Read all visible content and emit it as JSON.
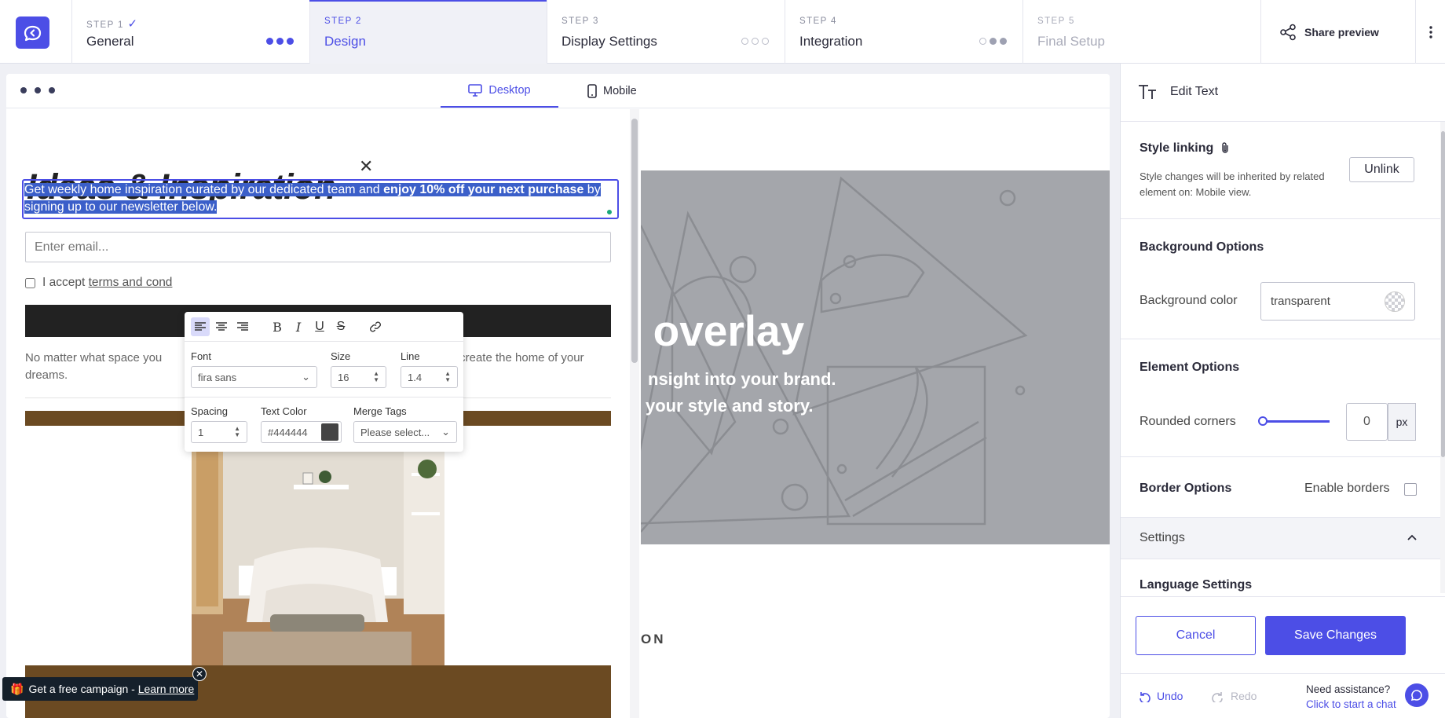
{
  "steps": [
    {
      "label": "STEP 1",
      "check": "✓",
      "name": "General"
    },
    {
      "label": "STEP 2",
      "name": "Design"
    },
    {
      "label": "STEP 3",
      "name": "Display Settings"
    },
    {
      "label": "STEP 4",
      "name": "Integration"
    },
    {
      "label": "STEP 5",
      "name": "Final Setup"
    }
  ],
  "header": {
    "share": "Share preview"
  },
  "canvas": {
    "desktop": "Desktop",
    "mobile": "Mobile"
  },
  "popup": {
    "headline": "Ideas & Inspiration",
    "text_pre": "Get weekly home inspiration curated by our dedicated team and ",
    "text_bold": "enjoy 10% off your next purchase",
    "text_post": " by signing up to our newsletter below.",
    "email_placeholder": "Enter email...",
    "terms_pre": "I accept ",
    "terms_link": "terms and cond",
    "smallprint_pre": "No matter what space you",
    "smallprint_post": "o you create the home of your dreams."
  },
  "overlay": {
    "headline": "t overlay",
    "line1": "nsight into your brand.",
    "line2": "your style and story.",
    "section": "ON"
  },
  "toolbar": {
    "font_label": "Font",
    "font_value": "fira sans",
    "size_label": "Size",
    "size_value": "16",
    "line_label": "Line",
    "line_value": "1.4",
    "spacing_label": "Spacing",
    "spacing_value": "1",
    "color_label": "Text Color",
    "color_value": "#444444",
    "merge_label": "Merge Tags",
    "merge_value": "Please select..."
  },
  "panel": {
    "title": "Edit Text",
    "style_linking": "Style linking",
    "style_desc": "Style changes will be inherited by related element on: Mobile view.",
    "unlink": "Unlink",
    "bg_options": "Background Options",
    "bg_color_label": "Background color",
    "bg_color_value": "transparent",
    "element_options": "Element Options",
    "rounded_label": "Rounded corners",
    "rounded_value": "0",
    "rounded_unit": "px",
    "border_options": "Border Options",
    "enable_borders": "Enable borders",
    "settings": "Settings",
    "language": "Language Settings",
    "cancel": "Cancel",
    "save": "Save Changes",
    "undo": "Undo",
    "redo": "Redo",
    "help_title": "Need assistance?",
    "help_link": "Click to start a chat"
  },
  "promo": {
    "text": "Get a free campaign - ",
    "link": "Learn more"
  },
  "colors": {
    "accent": "#4c4ee6",
    "selection": "#3b5fc9",
    "text_color": "#444444"
  }
}
